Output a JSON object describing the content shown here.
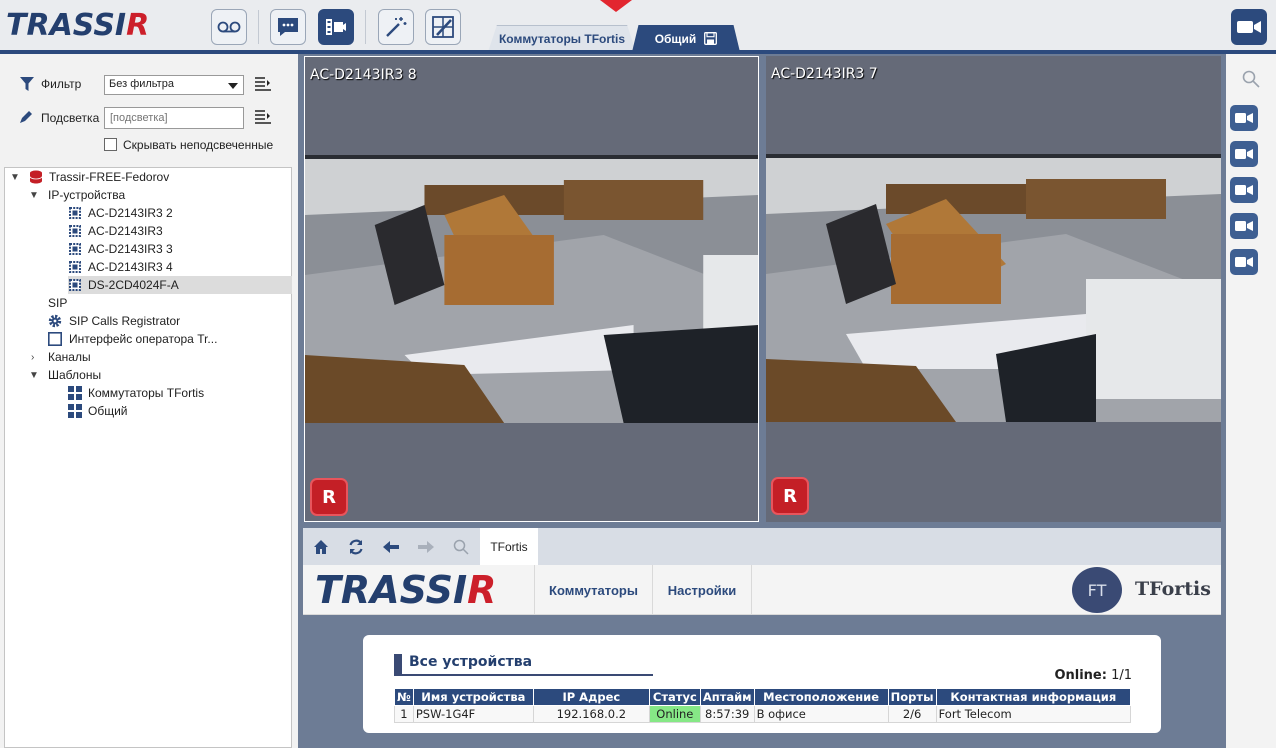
{
  "app": {
    "logo_text": "TRASSIR",
    "toolbar_buttons": [
      {
        "name": "voicemail-icon"
      },
      {
        "name": "chat-icon"
      },
      {
        "name": "video-schedule-icon"
      },
      {
        "name": "magic-wand-icon"
      },
      {
        "name": "layout-edit-icon"
      }
    ],
    "tabs": [
      {
        "label": "Коммутаторы TFortis"
      },
      {
        "label": "Общий"
      }
    ],
    "accent": "#2c4a7d",
    "brand_red": "#cc1f2a"
  },
  "filter": {
    "filter_label": "Фильтр",
    "filter_value": "Без фильтра",
    "highlight_label": "Подсветка",
    "highlight_placeholder": "[подсветка]",
    "hide_unhighlighted_label": "Скрывать неподсвеченные"
  },
  "tree": {
    "server": "Trassir-FREE-Fedorov",
    "ip_devices_label": "IP-устройства",
    "devices": [
      "AC-D2143IR3 2",
      "AC-D2143IR3",
      "AC-D2143IR3 3",
      "AC-D2143IR3 4",
      "DS-2CD4024F-A"
    ],
    "selected_device": "DS-2CD4024F-A",
    "sip_label": "SIP",
    "sip_calls": "SIP Calls Registrator",
    "operator_interface": "Интерфейс оператора Tr...",
    "channels_label": "Каналы",
    "templates_label": "Шаблоны",
    "templates": [
      "Коммутаторы TFortis",
      "Общий"
    ]
  },
  "video": {
    "cameras": [
      {
        "title": "AC-D2143IR3 8",
        "badge": "R"
      },
      {
        "title": "AC-D2143IR3 7",
        "badge": "R"
      }
    ]
  },
  "browser": {
    "tab_label": "TFortis",
    "site_logo": "TRASSIR",
    "nav": [
      "Коммутаторы",
      "Настройки"
    ],
    "partner_logo_mark": "FT",
    "partner_logo_text": "TFortis",
    "card_title": "Все устройства",
    "online_label": "Online:",
    "online_value": "1/1",
    "table": {
      "headers": [
        "№",
        "Имя устройства",
        "IP Адрес",
        "Статус",
        "Аптайм",
        "Местоположение",
        "Порты",
        "Контактная информация"
      ],
      "rows": [
        [
          "1",
          "PSW-1G4F",
          "192.168.0.2",
          "Online",
          "8:57:39",
          "В офисе",
          "2/6",
          "Fort Telecom"
        ]
      ]
    }
  }
}
